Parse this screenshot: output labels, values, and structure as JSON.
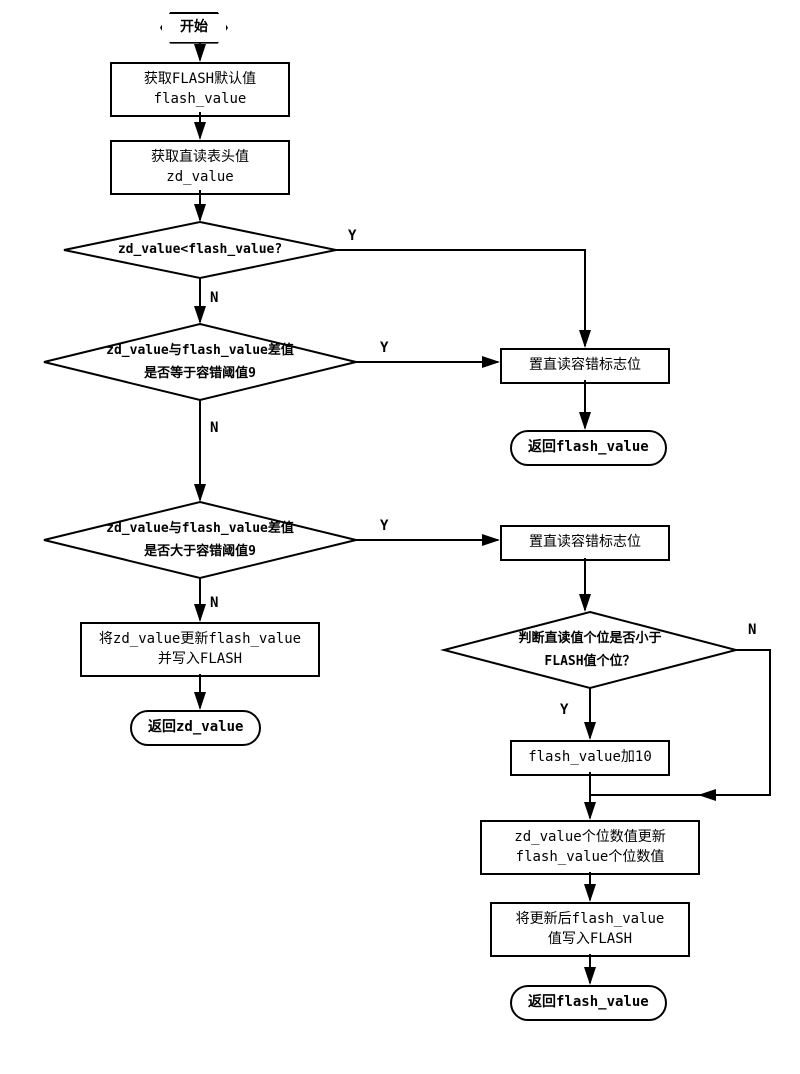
{
  "start": "开始",
  "step1_l1": "获取FLASH默认值",
  "step1_l2": "flash_value",
  "step2_l1": "获取直读表头值",
  "step2_l2": "zd_value",
  "dec1": "zd_value<flash_value?",
  "dec2_l1": "zd_value与flash_value差值",
  "dec2_l2": "是否等于容错阈值9",
  "dec3_l1": "zd_value与flash_value差值",
  "dec3_l2": "是否大于容错阈值9",
  "dec4_l1": "判断直读值个位是否小于",
  "dec4_l2": "FLASH值个位？",
  "step_set_flag1": "置直读容错标志位",
  "step_set_flag2": "置直读容错标志位",
  "step_update_left_l1": "将zd_value更新flash_value",
  "step_update_left_l2": "并写入FLASH",
  "ret_zd": "返回zd_value",
  "ret_flash1": "返回flash_value",
  "ret_flash2": "返回flash_value",
  "step_add10": "flash_value加10",
  "step_update_digit_l1": "zd_value个位数值更新",
  "step_update_digit_l2": "flash_value个位数值",
  "step_write_flash_l1": "将更新后flash_value",
  "step_write_flash_l2": "值写入FLASH",
  "Y": "Y",
  "N": "N"
}
